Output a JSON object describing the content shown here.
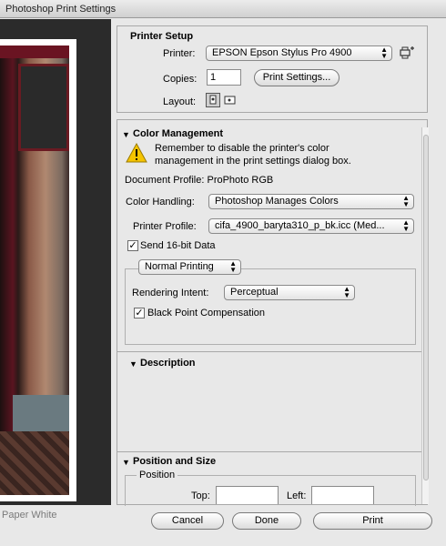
{
  "window": {
    "title": "Photoshop Print Settings"
  },
  "preview": {
    "caption": "Paper White"
  },
  "printer_setup": {
    "title": "Printer Setup",
    "printer_label": "Printer:",
    "printer_value": "EPSON Epson Stylus Pro 4900",
    "copies_label": "Copies:",
    "copies_value": "1",
    "print_settings_button": "Print Settings...",
    "layout_label": "Layout:"
  },
  "color_management": {
    "title": "Color Management",
    "warning_line1": "Remember to disable the printer's color",
    "warning_line2": "management in the print settings dialog box.",
    "document_profile": "Document Profile: ProPhoto RGB",
    "color_handling_label": "Color Handling:",
    "color_handling_value": "Photoshop Manages Colors",
    "printer_profile_label": "Printer Profile:",
    "printer_profile_value": "cifa_4900_baryta310_p_bk.icc (Med...",
    "send16_label": "Send 16-bit Data",
    "send16_checked": "✓",
    "normal_printing": "Normal Printing",
    "rendering_intent_label": "Rendering Intent:",
    "rendering_intent_value": "Perceptual",
    "bpc_label": "Black Point Compensation",
    "bpc_checked": "✓"
  },
  "description": {
    "title": "Description"
  },
  "position_size": {
    "title": "Position and Size",
    "position_label": "Position",
    "top_label": "Top:",
    "left_label": "Left:"
  },
  "buttons": {
    "cancel": "Cancel",
    "done": "Done",
    "print": "Print"
  }
}
